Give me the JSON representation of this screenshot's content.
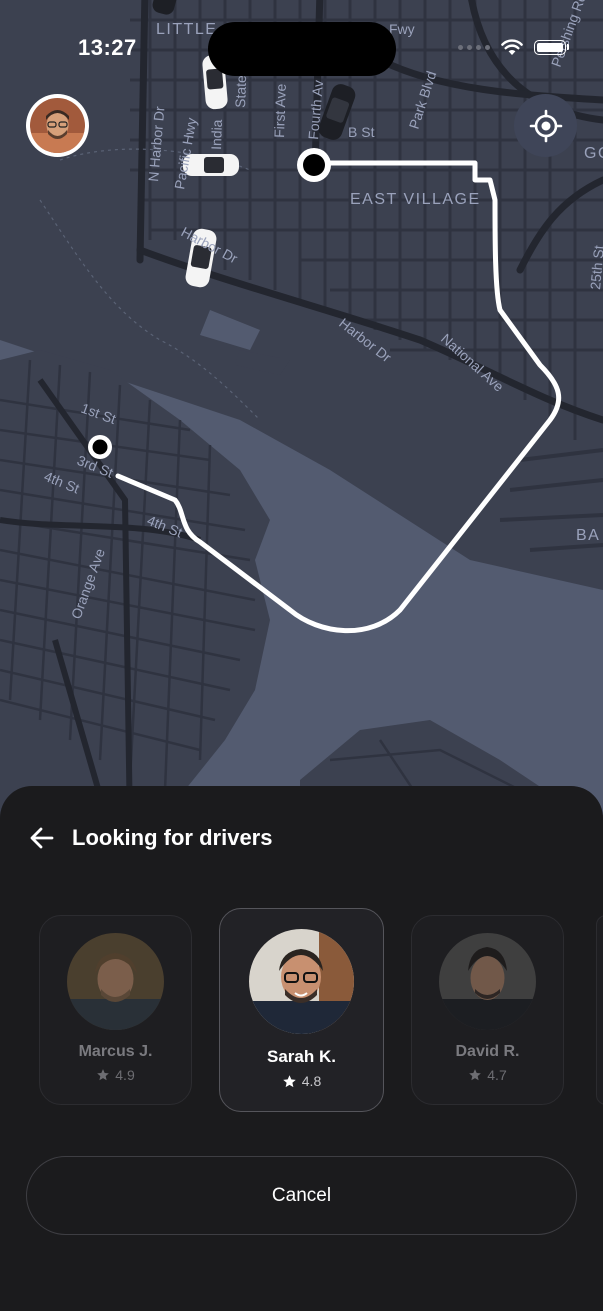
{
  "status_bar": {
    "time": "13:27",
    "signal_icon": "cellular-dots-icon",
    "wifi_icon": "wifi-icon",
    "battery_icon": "battery-icon"
  },
  "map": {
    "labels": {
      "little_italy": "LITTLE",
      "fwy": "Fwy",
      "pershing": "Pershing Rd",
      "park_blvd": "Park Blvd",
      "fourth_ave": "Fourth Av",
      "first_ave": "First Ave",
      "india": "India",
      "state": "State",
      "b_st": "B St",
      "go": "GO",
      "n_harbor": "N Harbor Dr",
      "pacific_hwy": "Pacific Hwy",
      "east_village": "EAST VILLAGE",
      "harbor_dr_1": "Harbor Dr",
      "harbor_dr_2": "Harbor Dr",
      "national_ave": "National Ave",
      "st_25": "25th St",
      "first_st": "1st St",
      "third_st": "3rd St",
      "fourth_st_1": "4th St",
      "fourth_st_2": "4th St",
      "orange_ave": "Orange Ave",
      "ba": "BA"
    },
    "profile_avatar": "user-avatar",
    "locate_icon": "crosshair-locate-icon",
    "colors": {
      "land": "#3c4150",
      "water": "#525a6e",
      "route": "#ffffff"
    }
  },
  "sheet": {
    "title": "Looking for drivers",
    "back_icon": "arrow-left-icon",
    "drivers": [
      {
        "name": "Marcus J.",
        "rating": "4.9",
        "selected": false
      },
      {
        "name": "Sarah K.",
        "rating": "4.8",
        "selected": true
      },
      {
        "name": "David R.",
        "rating": "4.7",
        "selected": false
      }
    ],
    "cancel_label": "Cancel"
  }
}
